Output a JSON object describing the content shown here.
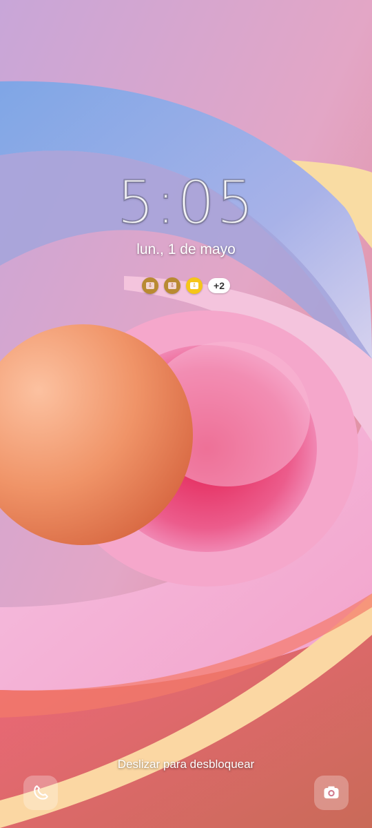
{
  "lockscreen": {
    "time": "5:05",
    "date": "lun., 1 de mayo",
    "notifications": {
      "icons": [
        {
          "name": "download-app-icon",
          "color": "#b98a32"
        },
        {
          "name": "download-app-icon",
          "color": "#b98a32"
        },
        {
          "name": "download-icon",
          "color": "#f6c619"
        }
      ],
      "more_count": "+2"
    },
    "swipe_hint": "Deslizar para desbloquear",
    "shortcuts": {
      "left": "phone-icon",
      "right": "camera-icon"
    }
  }
}
